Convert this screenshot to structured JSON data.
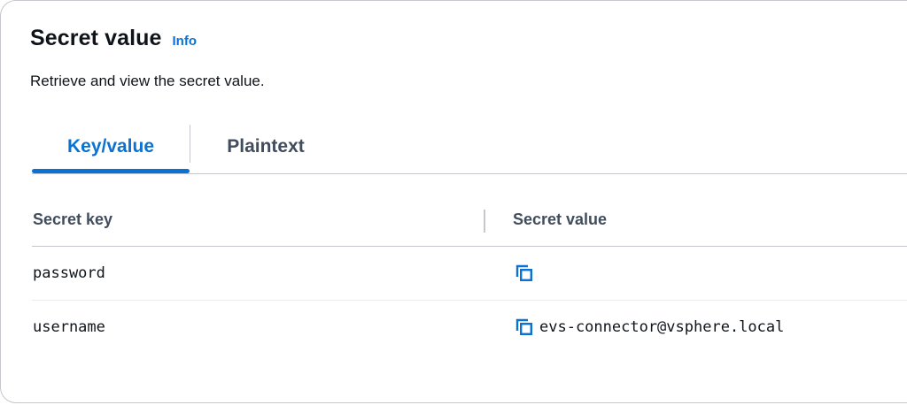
{
  "header": {
    "title": "Secret value",
    "info_label": "Info",
    "description": "Retrieve and view the secret value."
  },
  "tabs": [
    {
      "label": "Key/value",
      "active": true
    },
    {
      "label": "Plaintext",
      "active": false
    }
  ],
  "table": {
    "columns": [
      "Secret key",
      "Secret value"
    ],
    "rows": [
      {
        "key": "password",
        "value": ""
      },
      {
        "key": "username",
        "value": "evs-connector@vsphere.local"
      }
    ]
  },
  "icons": {
    "copy": "copy-icon"
  },
  "colors": {
    "accent": "#0972d3",
    "border": "#c6c6cd",
    "text": "#0f141a",
    "muted": "#414d5c"
  }
}
